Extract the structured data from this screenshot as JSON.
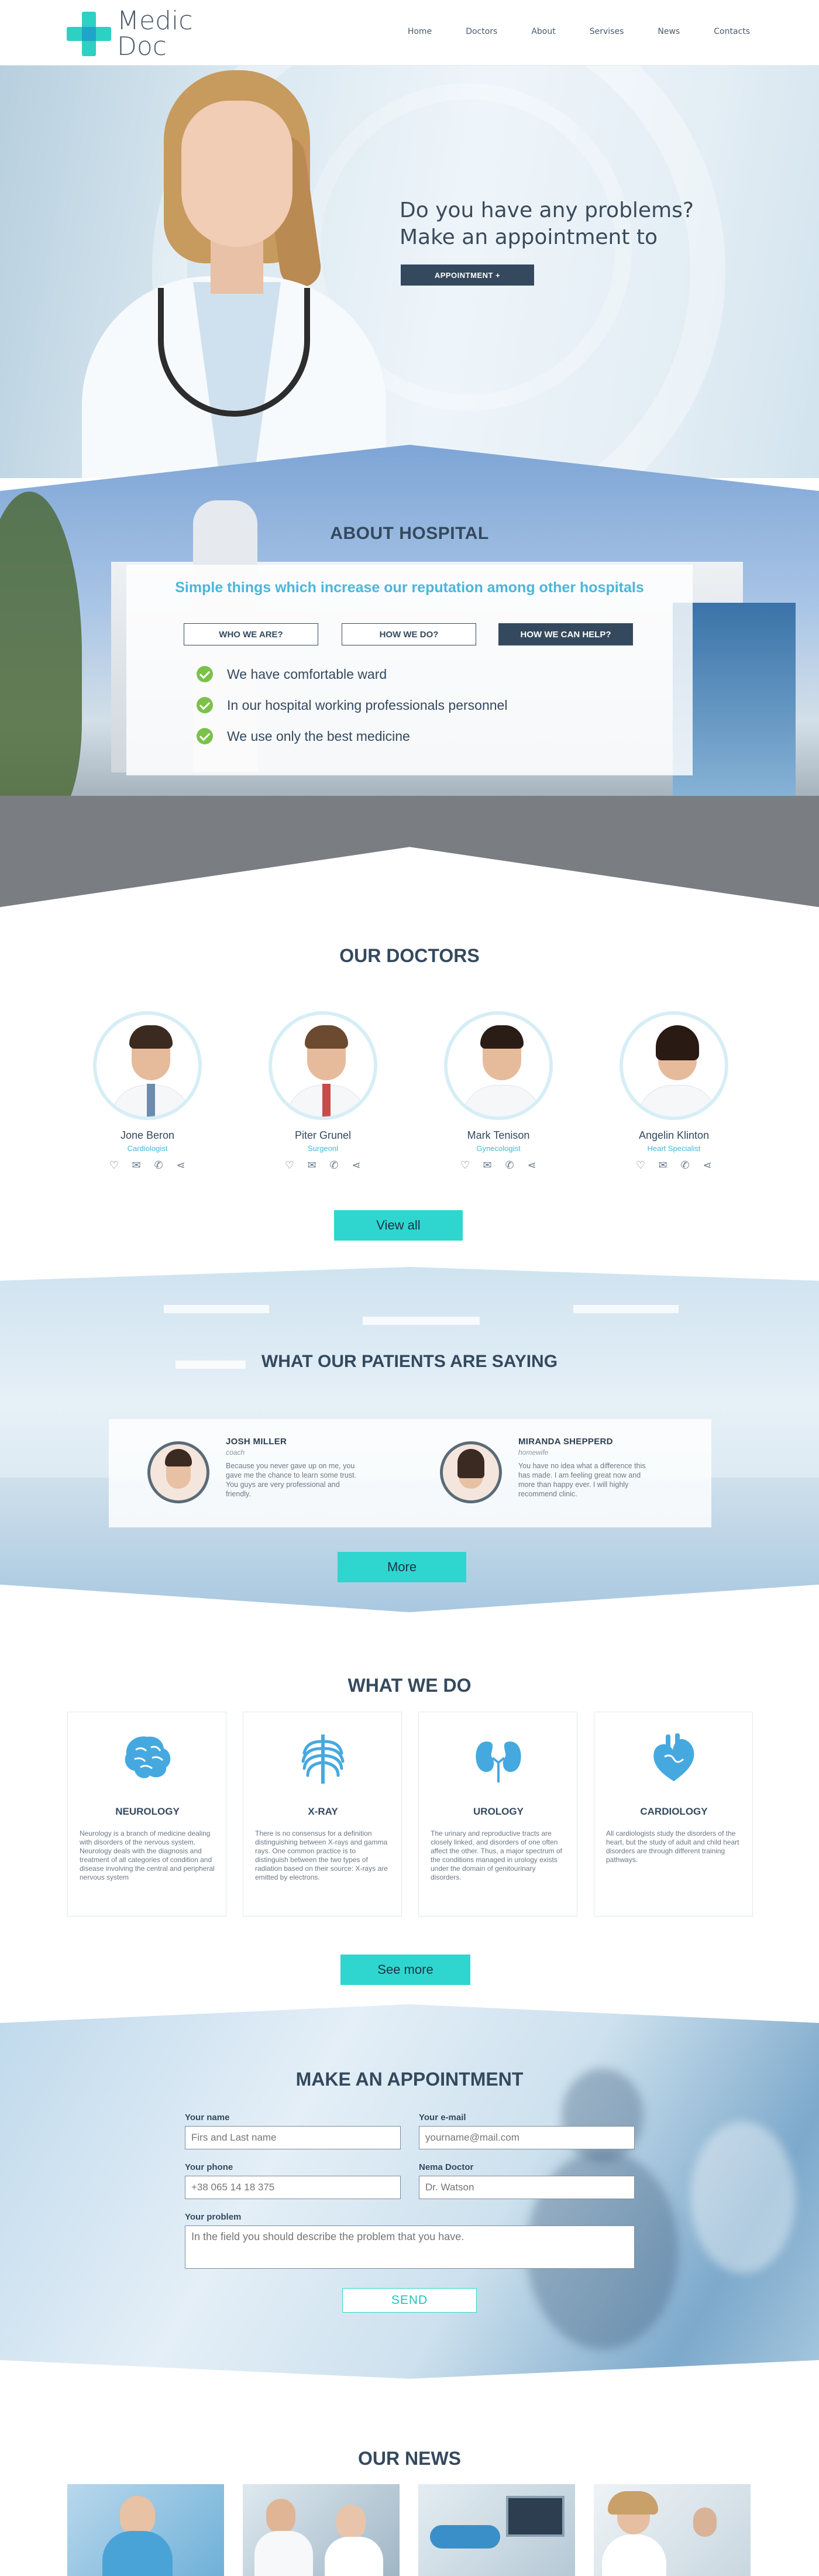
{
  "header": {
    "logo_line1": "Medic",
    "logo_line2": "Doc",
    "nav": [
      "Home",
      "Doctors",
      "About",
      "Servises",
      "News",
      "Contacts"
    ]
  },
  "hero": {
    "title_line1": "Do you have any problems?",
    "title_line2": "Make an appointment to",
    "appointment_button": "APPOINTMENT +"
  },
  "about": {
    "title": "ABOUT HOSPITAL",
    "subtitle": "Simple things which increase our reputation among other hospitals",
    "tabs": [
      "WHO WE ARE?",
      "HOW WE DO?",
      "HOW WE CAN HELP?"
    ],
    "active_tab": "HOW WE CAN HELP?",
    "features": [
      "We have comfortable ward",
      "In our hospital working professionals personnel",
      "We use only the best medicine"
    ]
  },
  "doctors": {
    "title": "OUR DOCTORS",
    "list": [
      {
        "name": "Jone Beron",
        "role": "Cardiologist"
      },
      {
        "name": "Piter Grunel",
        "role": "Surgeonl"
      },
      {
        "name": "Mark Tenison",
        "role": "Gynecologist"
      },
      {
        "name": "Angelin Klinton",
        "role": "Heart Specialist"
      }
    ],
    "contact_icons": [
      "heart-icon",
      "mail-icon",
      "phone-icon",
      "share-icon"
    ],
    "view_all": "View all"
  },
  "testimonials": {
    "title": "WHAT OUR PATIENTS ARE SAYING",
    "items": [
      {
        "name": "JOSH MILLER",
        "role": "coach",
        "text": "Because you never gave up on me, you gave me the chance to learn some trust. You guys are very professional and friendly."
      },
      {
        "name": "MIRANDA SHEPPERD",
        "role": "homewife",
        "text": "You have no idea what a difference this has made. I am feeling great now and more than happy ever. I will highly recommend clinic."
      }
    ],
    "more": "More"
  },
  "services": {
    "title": "WHAT WE DO",
    "items": [
      {
        "name": "NEUROLOGY",
        "icon": "brain-icon",
        "text": "Neurology is a branch of medicine dealing with disorders of the nervous system. Neurology deals with the diagnosis and treatment of all categories of condition and disease involving the central and peripheral nervous system"
      },
      {
        "name": "X-RAY",
        "icon": "ribcage-icon",
        "text": "There is no consensus for a definition distinguishing between X-rays and gamma rays. One common practice is to distinguish between the two types of radiation based on their source: X-rays are emitted by electrons."
      },
      {
        "name": "UROLOGY",
        "icon": "kidneys-icon",
        "text": "The urinary and reproductive tracts are closely linked, and disorders of one often affect the other. Thus, a major spectrum of the conditions managed in urology exists under the domain of genitourinary disorders."
      },
      {
        "name": "CARDIOLOGY",
        "icon": "heart-organ-icon",
        "text": "All cardiologists study the disorders of the heart, but the study of adult and child heart disorders are through different training pathways."
      }
    ],
    "see_more": "See more"
  },
  "appointment": {
    "title": "MAKE AN APPOINTMENT",
    "name_label": "Your name",
    "name_placeholder": "Firs and Last name",
    "email_label": "Your e-mail",
    "email_placeholder": "yourname@mail.com",
    "phone_label": "Your phone",
    "phone_placeholder": "+38 065 14 18 375",
    "doctor_label": "Nema Doctor",
    "doctor_placeholder": "Dr. Watson",
    "problem_label": "Your problem",
    "problem_placeholder": "In the field you should describe the problem that you have.",
    "send": "SEND"
  },
  "news": {
    "title": "OUR NEWS"
  },
  "colors": {
    "accent_teal": "#2fd6cf",
    "dark_navy": "#34495e",
    "light_blue": "#4bb6da",
    "check_green": "#7bc24a"
  }
}
